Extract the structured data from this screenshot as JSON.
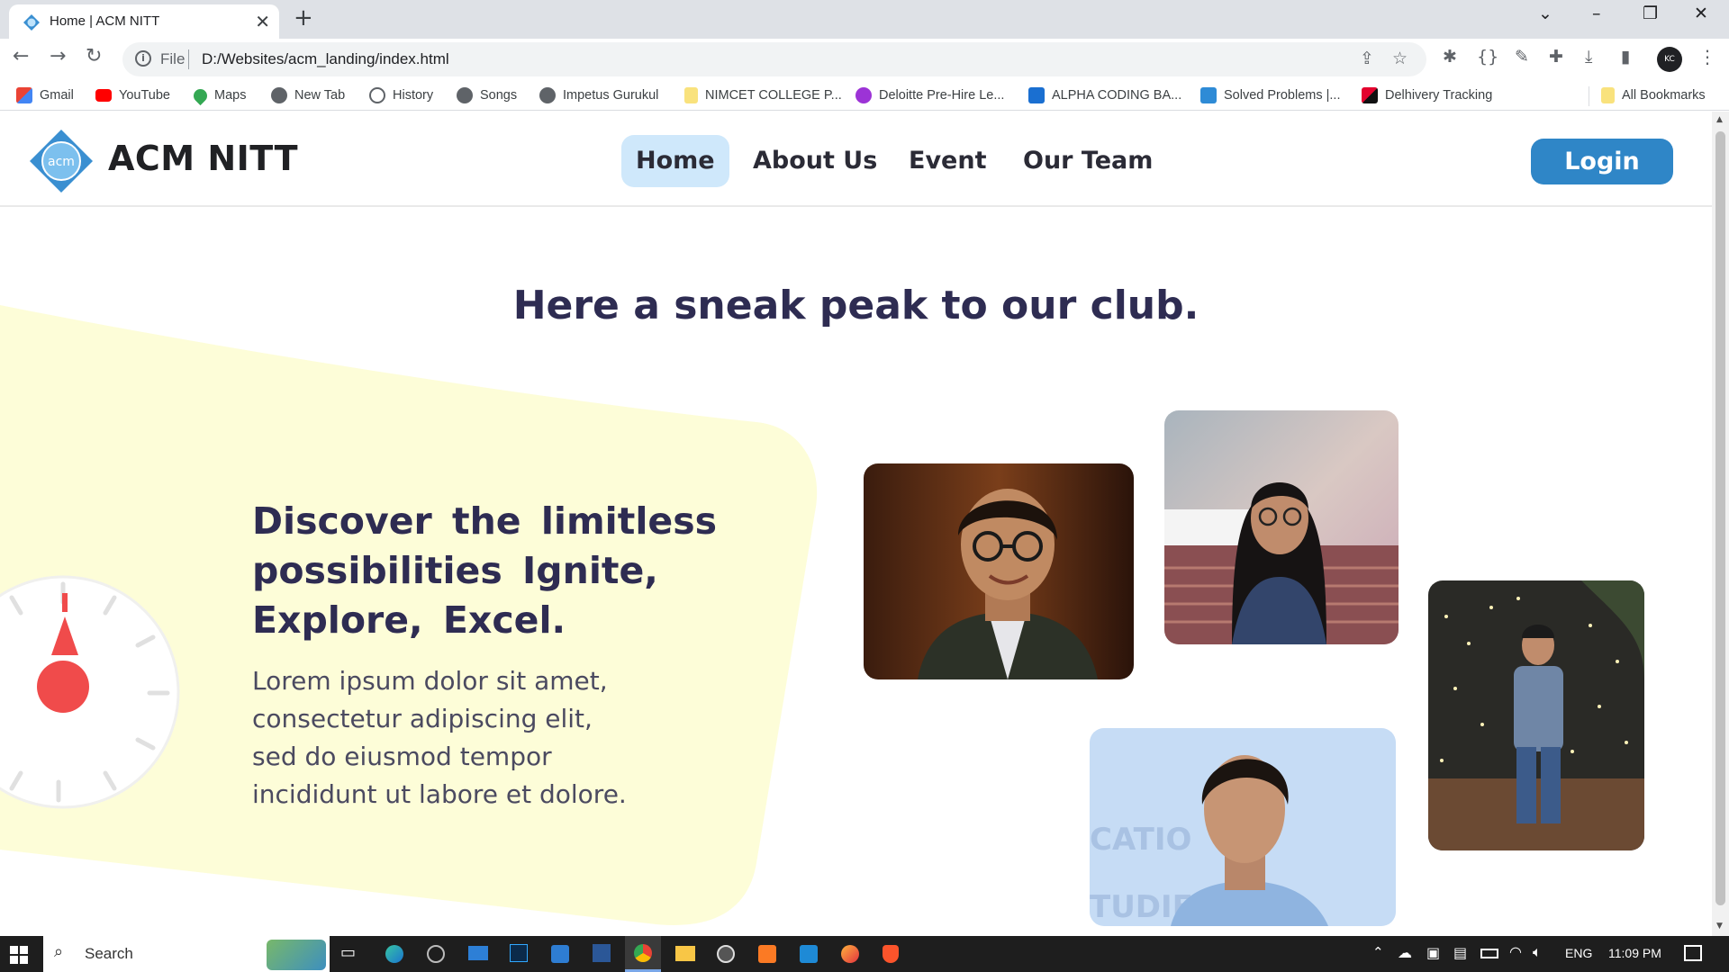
{
  "browser": {
    "tab_title": "Home | ACM NITT",
    "tab_close": "✕",
    "new_tab": "+",
    "address_scheme": "File",
    "address_url": "D:/Websites/acm_landing/index.html",
    "profile_initials": "KC",
    "bookmarks": [
      {
        "label": "Gmail",
        "icon": "gmail-icon",
        "color": "#ea4335"
      },
      {
        "label": "YouTube",
        "icon": "youtube-icon",
        "color": "#ff0000"
      },
      {
        "label": "Maps",
        "icon": "maps-icon",
        "color": "#34a853"
      },
      {
        "label": "New Tab",
        "icon": "newtab-icon",
        "color": "#5f6368"
      },
      {
        "label": "History",
        "icon": "history-icon",
        "color": "#5f6368"
      },
      {
        "label": "Songs",
        "icon": "globe-icon",
        "color": "#5f6368"
      },
      {
        "label": "Impetus Gurukul",
        "icon": "globe-icon",
        "color": "#5f6368"
      },
      {
        "label": "NIMCET COLLEGE P...",
        "icon": "folder-icon",
        "color": "#f9d65c"
      },
      {
        "label": "Deloitte Pre-Hire Le...",
        "icon": "deloitte-icon",
        "color": "#9c33d6"
      },
      {
        "label": "ALPHA CODING BA...",
        "icon": "alpha-icon",
        "color": "#1a6fd1"
      },
      {
        "label": "Solved Problems |...",
        "icon": "dsa-icon",
        "color": "#2e8bd6"
      },
      {
        "label": "Delhivery Tracking",
        "icon": "delhivery-icon",
        "color": "#e4032e"
      }
    ],
    "all_bookmarks": "All Bookmarks"
  },
  "site": {
    "brand": "ACM NITT",
    "logo_text": "acm",
    "nav": [
      "Home",
      "About Us",
      "Event",
      "Our Team"
    ],
    "login": "Login",
    "section_title": "Here a sneak peak to our club.",
    "hero_heading": "Discover the limitless possibilities Ignite, Explore, Excel.",
    "hero_body": "Lorem ipsum dolor sit amet, consectetur adipiscing elit, sed do eiusmod tempor incididunt ut labore et dolore."
  },
  "colors": {
    "accent": "#2f86c7",
    "nav_active_bg": "#cfe8fb",
    "heading": "#2e2c52",
    "blob": "#fdfdd8",
    "clock_hand": "#f04b4b"
  },
  "taskbar": {
    "search": "Search",
    "language": "ENG",
    "time": "11:09 PM"
  }
}
